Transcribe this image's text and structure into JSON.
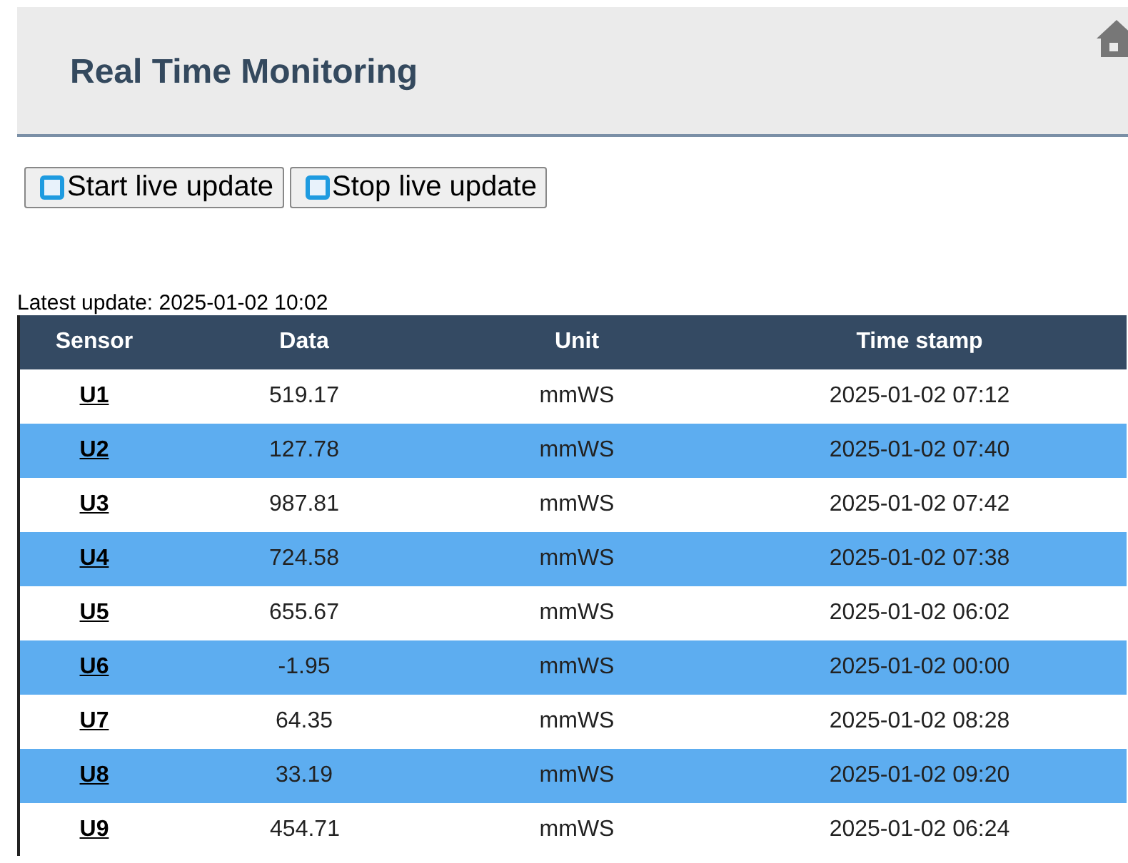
{
  "header": {
    "title": "Real Time Monitoring"
  },
  "buttons": [
    {
      "label": "Start live update"
    },
    {
      "label": "Stop live update"
    }
  ],
  "latest_update": "Latest update: 2025-01-02 10:02",
  "table": {
    "columns": [
      "Sensor",
      "Data",
      "Unit",
      "Time stamp"
    ],
    "rows": [
      {
        "sensor": "U1",
        "data": "519.17",
        "unit": "mmWS",
        "time": "2025-01-02 07:12"
      },
      {
        "sensor": "U2",
        "data": "127.78",
        "unit": "mmWS",
        "time": "2025-01-02 07:40"
      },
      {
        "sensor": "U3",
        "data": "987.81",
        "unit": "mmWS",
        "time": "2025-01-02 07:42"
      },
      {
        "sensor": "U4",
        "data": "724.58",
        "unit": "mmWS",
        "time": "2025-01-02 07:38"
      },
      {
        "sensor": "U5",
        "data": "655.67",
        "unit": "mmWS",
        "time": "2025-01-02 06:02"
      },
      {
        "sensor": "U6",
        "data": "-1.95",
        "unit": "mmWS",
        "time": "2025-01-02 00:00"
      },
      {
        "sensor": "U7",
        "data": "64.35",
        "unit": "mmWS",
        "time": "2025-01-02 08:28"
      },
      {
        "sensor": "U8",
        "data": "33.19",
        "unit": "mmWS",
        "time": "2025-01-02 09:20"
      },
      {
        "sensor": "U9",
        "data": "454.71",
        "unit": "mmWS",
        "time": "2025-01-02 06:24"
      }
    ]
  }
}
